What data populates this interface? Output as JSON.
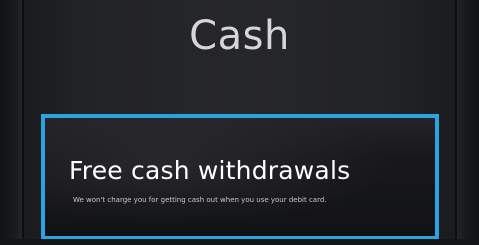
{
  "screen": {
    "title": "Cash"
  },
  "promo": {
    "heading": "Free cash withdrawals",
    "subtext": "We won't charge you for getting cash out when you use your debit card."
  },
  "colors": {
    "accent_border": "#2aa3e0",
    "background": "#1d1e22",
    "title_text": "#d6d6d9"
  }
}
